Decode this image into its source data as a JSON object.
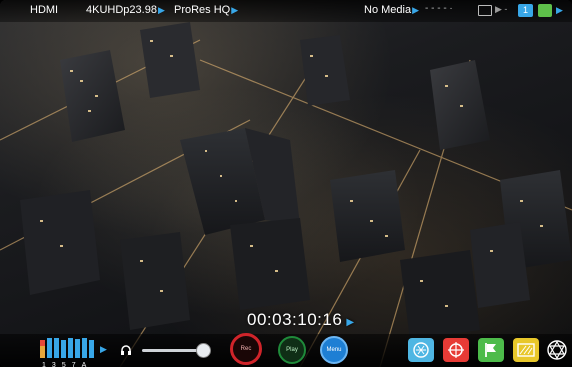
{
  "topbar": {
    "input": "HDMI",
    "format": "4KUHDp23.98",
    "codec": "ProRes HQ",
    "media": "No Media",
    "slot_one": "1"
  },
  "timecode": "00:03:10:16",
  "audio": {
    "channel_labels": [
      "1",
      "3",
      "5",
      "7",
      "A"
    ]
  },
  "buttons": {
    "rec": "Rec",
    "play": "Play",
    "menu": "Menu"
  },
  "colors": {
    "accent_blue": "#38a7e8",
    "battery_green": "#5ec04a",
    "rec_red": "#d0242a",
    "play_green": "#1f8a3a",
    "menu_blue": "#1e7fd4",
    "waveform": "#4fb6e3",
    "focus_red": "#e73b36",
    "tag_green": "#4dbb4a",
    "zebra_yellow": "#e8c72a"
  },
  "icons": [
    "headphones-icon",
    "nd-filter-icon",
    "focus-peaking-icon",
    "tag-flag-icon",
    "zebra-icon",
    "atomos-logo-icon"
  ]
}
